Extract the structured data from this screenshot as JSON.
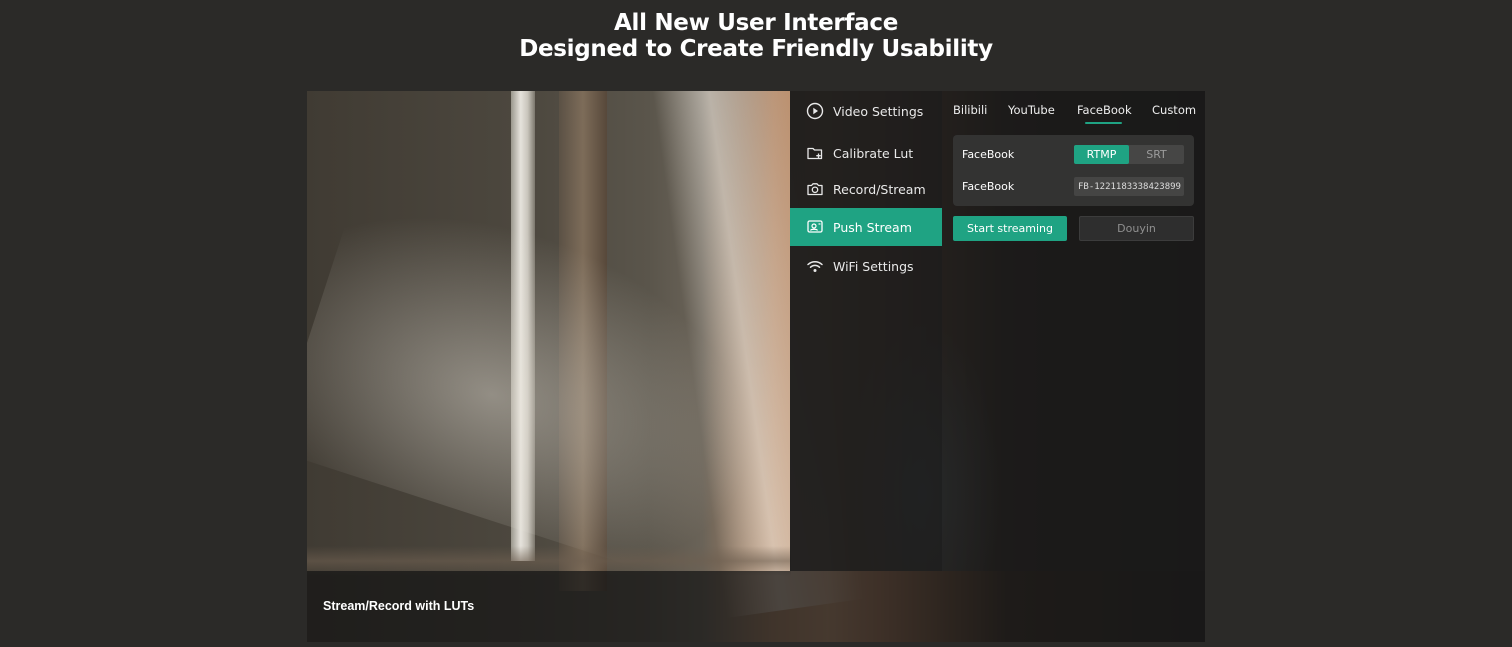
{
  "headline": {
    "line1": "All New User Interface",
    "line2": "Designed to Create Friendly Usability"
  },
  "caption": "Stream/Record with LUTs",
  "sidebar": {
    "items": [
      {
        "label": "Video Settings",
        "icon": "play-circle-icon",
        "active": false
      },
      {
        "label": "Calibrate Lut",
        "icon": "folder-plus-icon",
        "active": false
      },
      {
        "label": "Record/Stream",
        "icon": "camera-icon",
        "active": false
      },
      {
        "label": "Push Stream",
        "icon": "push-stream-icon",
        "active": true
      },
      {
        "label": "WiFi Settings",
        "icon": "wifi-icon",
        "active": false
      }
    ]
  },
  "tabs": [
    {
      "label": "Bilibili",
      "active": false
    },
    {
      "label": "YouTube",
      "active": false
    },
    {
      "label": "FaceBook",
      "active": true
    },
    {
      "label": "Custom",
      "active": false
    }
  ],
  "settings": {
    "protocol_label": "FaceBook",
    "protocol_options": [
      "RTMP",
      "SRT"
    ],
    "protocol_selected": "RTMP",
    "key_label": "FaceBook",
    "key_value": "FB-1221183338423899"
  },
  "actions": {
    "start_label": "Start streaming",
    "douyin_label": "Douyin"
  },
  "colors": {
    "accent": "#1fa383",
    "background": "#2b2a28"
  }
}
